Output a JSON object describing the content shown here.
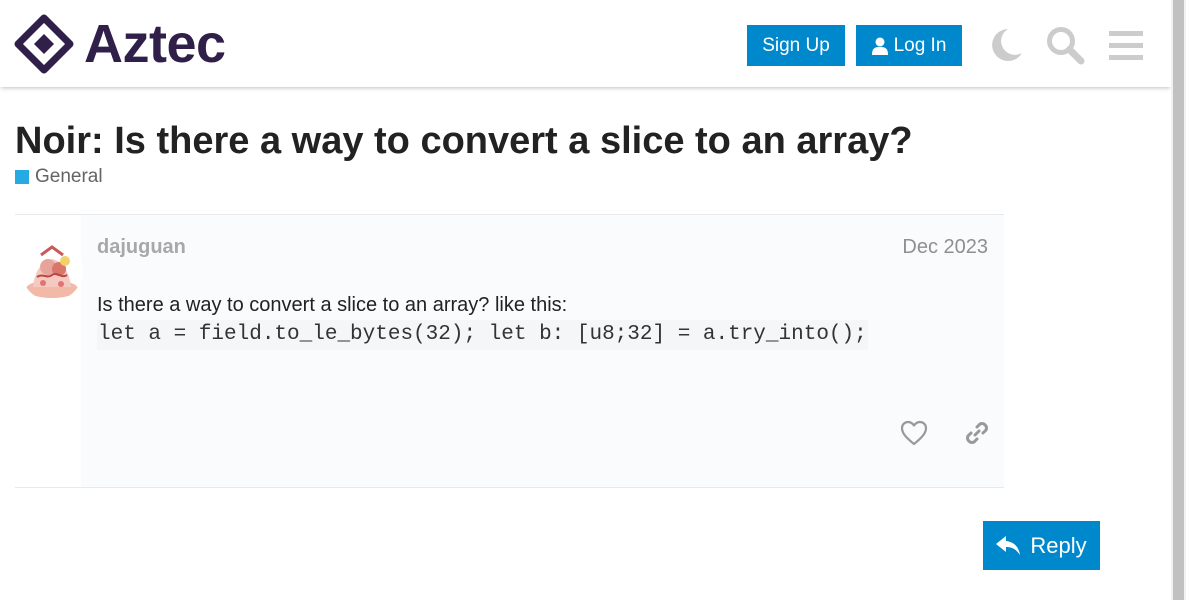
{
  "header": {
    "logo_text": "Aztec",
    "signup_label": "Sign Up",
    "login_label": "Log In",
    "icons": [
      "moon-icon",
      "search-icon",
      "hamburger-menu-icon"
    ]
  },
  "topic": {
    "title": "Noir: Is there a way to convert a slice to an array?",
    "category": "General",
    "category_color": "#25aae1"
  },
  "post": {
    "username": "dajuguan",
    "date": "Dec 2023",
    "text": "Is there a way to convert a slice to an array? like this:",
    "code": "let a = field.to_le_bytes(32); let b: [u8;32] = a.try_into();"
  },
  "footer": {
    "reply_label": "Reply"
  },
  "colors": {
    "brand": "#2f1f49",
    "primary": "#0088cc",
    "muted_icon": "#cccccc"
  }
}
